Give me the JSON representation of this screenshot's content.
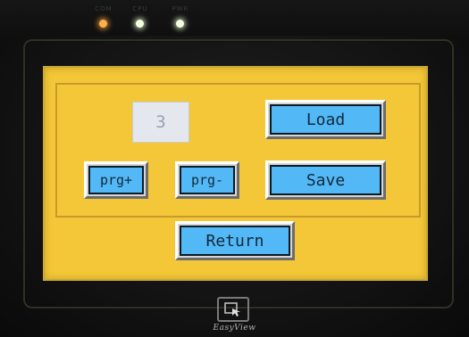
{
  "leds": [
    {
      "label": "COM",
      "color": "#ffb04a"
    },
    {
      "label": "CPU",
      "color": "#f4ffe0"
    },
    {
      "label": "PWR",
      "color": "#f4ffe0"
    }
  ],
  "screen": {
    "background": "#f3c737",
    "program_number": "3",
    "buttons": {
      "load": "Load",
      "save": "Save",
      "prg_plus": "prg+",
      "prg_minus": "prg-",
      "return": "Return"
    },
    "button_color": "#52b8f6"
  },
  "brand": {
    "logo_icon": "touch-hand-icon",
    "name": "EasyView"
  }
}
